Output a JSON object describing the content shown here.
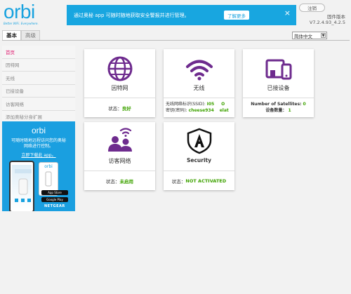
{
  "logo": {
    "text": "orbi",
    "subtitle": "Better WiFi. Everywhere."
  },
  "banner": {
    "text": "通过奥秘 app 可随时随地获取安全警报并进行管理。",
    "button": "了解更多",
    "close": "×"
  },
  "header": {
    "logout": "注销",
    "firmware_label": "固件版本",
    "firmware_version": "V7.2.4.93_4.2.5"
  },
  "tabs": [
    {
      "label": "基本"
    },
    {
      "label": "高级"
    }
  ],
  "language": {
    "selected": "简体中文"
  },
  "sidebar": {
    "items": [
      {
        "label": "首页"
      },
      {
        "label": "因特网"
      },
      {
        "label": "无线"
      },
      {
        "label": "已接设备"
      },
      {
        "label": "访客网络"
      },
      {
        "label": "添加奥秘分身扩展"
      }
    ]
  },
  "ad": {
    "logo": "orbi",
    "text": "可随时随地远程访问您的奥秘网络进行控制。",
    "link": "立即下载此 app。",
    "phone_logo": "orbi",
    "app_store": "App Store",
    "google_play": "Google Play",
    "brand": "NETGEAR"
  },
  "cards": {
    "internet": {
      "title": "因特网",
      "status_label": "状态：",
      "status_value": "良好"
    },
    "wireless": {
      "title": "无线",
      "ssid_label": "无线网络标识(SSID):",
      "ssid_value": "I05",
      "ssid_extra": "O",
      "password_label": "密钥(密码):",
      "password_value": "cheese934",
      "password_extra": "elat"
    },
    "devices": {
      "title": "已接设备",
      "satellites_label": "Number of Satellites:",
      "satellites_value": "0",
      "count_label": "设备数量：",
      "count_value": "1"
    },
    "guest": {
      "title": "访客网络",
      "status_label": "状态：",
      "status_value": "未启用"
    },
    "security": {
      "title": "Security",
      "status_label": "状态：",
      "status_value": "NOT ACTIVATED"
    }
  },
  "colors": {
    "accent": "#17a2df",
    "purple": "#6e2b8e",
    "status_green": "#3ea200",
    "active_nav": "#e0196e"
  }
}
